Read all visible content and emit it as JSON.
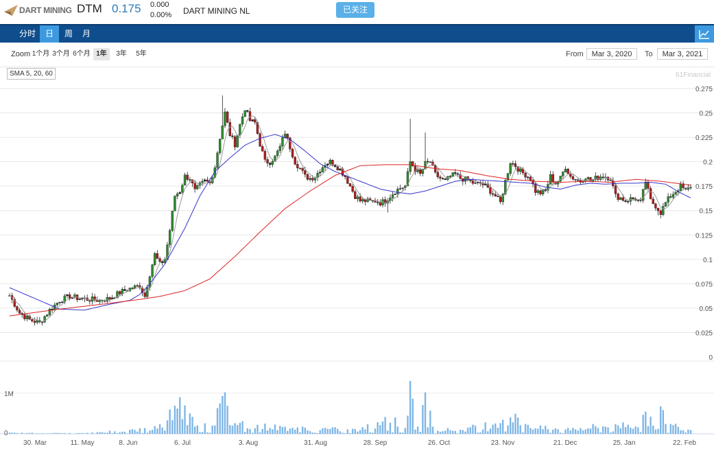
{
  "header": {
    "logo_text": "DART MINING",
    "ticker": "DTM",
    "price": "0.175",
    "change": "0.000",
    "change_pct": "0.00%",
    "company": "DART MINING NL",
    "follow_label": "已关注"
  },
  "nav": {
    "tabs": [
      {
        "label": "分时",
        "active": false
      },
      {
        "label": "日",
        "active": true
      },
      {
        "label": "周",
        "active": false
      },
      {
        "label": "月",
        "active": false
      }
    ],
    "chart_toggle_icon": "line-chart-icon"
  },
  "toolbar": {
    "zoom_label": "Zoom",
    "zoom_options": [
      {
        "label": "1个月",
        "active": false
      },
      {
        "label": "3个月",
        "active": false
      },
      {
        "label": "6个月",
        "active": false
      },
      {
        "label": "1年",
        "active": true
      },
      {
        "label": "3年",
        "active": false
      },
      {
        "label": "5年",
        "active": false
      }
    ],
    "from_label": "From",
    "from_value": "Mar 3, 2020",
    "to_label": "To",
    "to_value": "Mar 3, 2021"
  },
  "indicator_label": "SMA 5, 20, 60",
  "credit": "61Financial",
  "colors": {
    "up": "#2e8b2e",
    "down": "#b01c1c",
    "sma5": "#999999",
    "sma20": "#3333cc",
    "sma60": "#dd2222",
    "volume": "#7eb6e6",
    "nav_bg": "#0f4d8c",
    "accent": "#3d9ae0"
  },
  "chart_data": {
    "type": "candlestick",
    "y_ticks": [
      "0.275",
      "0.25",
      "0.225",
      "0.2",
      "0.175",
      "0.15",
      "0.125",
      "0.1",
      "0.075",
      "0.05",
      "0.025",
      "0"
    ],
    "ylim": [
      0,
      0.275
    ],
    "volume_ticks": [
      "1M",
      "0"
    ],
    "x_ticks": [
      "30. Mar",
      "11. May",
      "8. Jun",
      "6. Jul",
      "3. Aug",
      "31. Aug",
      "28. Sep",
      "26. Oct",
      "23. Nov",
      "21. Dec",
      "25. Jan",
      "22. Feb"
    ],
    "series": [
      {
        "name": "SMA 5",
        "kind": "line"
      },
      {
        "name": "SMA 20",
        "kind": "line"
      },
      {
        "name": "SMA 60",
        "kind": "line"
      }
    ],
    "sma20_knots": [
      [
        0,
        0.071
      ],
      [
        10,
        0.06
      ],
      [
        20,
        0.049
      ],
      [
        30,
        0.048
      ],
      [
        40,
        0.054
      ],
      [
        48,
        0.058
      ],
      [
        52,
        0.064
      ],
      [
        56,
        0.075
      ],
      [
        62,
        0.095
      ],
      [
        70,
        0.132
      ],
      [
        76,
        0.165
      ],
      [
        82,
        0.19
      ],
      [
        88,
        0.204
      ],
      [
        94,
        0.217
      ],
      [
        100,
        0.224
      ],
      [
        106,
        0.228
      ],
      [
        112,
        0.223
      ],
      [
        118,
        0.211
      ],
      [
        124,
        0.198
      ],
      [
        130,
        0.19
      ],
      [
        136,
        0.184
      ],
      [
        142,
        0.178
      ],
      [
        148,
        0.172
      ],
      [
        154,
        0.169
      ],
      [
        160,
        0.167
      ],
      [
        166,
        0.17
      ],
      [
        172,
        0.175
      ],
      [
        178,
        0.18
      ],
      [
        184,
        0.182
      ],
      [
        190,
        0.181
      ],
      [
        196,
        0.18
      ],
      [
        202,
        0.179
      ],
      [
        208,
        0.178
      ],
      [
        214,
        0.174
      ],
      [
        220,
        0.172
      ],
      [
        226,
        0.176
      ],
      [
        232,
        0.178
      ],
      [
        238,
        0.177
      ],
      [
        244,
        0.178
      ],
      [
        250,
        0.178
      ],
      [
        256,
        0.179
      ],
      [
        262,
        0.177
      ],
      [
        268,
        0.168
      ],
      [
        272,
        0.163
      ]
    ],
    "sma60_knots": [
      [
        0,
        0.042
      ],
      [
        20,
        0.049
      ],
      [
        40,
        0.055
      ],
      [
        52,
        0.059
      ],
      [
        60,
        0.062
      ],
      [
        70,
        0.068
      ],
      [
        80,
        0.08
      ],
      [
        90,
        0.103
      ],
      [
        100,
        0.128
      ],
      [
        110,
        0.152
      ],
      [
        120,
        0.17
      ],
      [
        130,
        0.186
      ],
      [
        140,
        0.196
      ],
      [
        150,
        0.197
      ],
      [
        160,
        0.197
      ],
      [
        170,
        0.193
      ],
      [
        180,
        0.191
      ],
      [
        190,
        0.186
      ],
      [
        200,
        0.182
      ],
      [
        210,
        0.18
      ],
      [
        220,
        0.179
      ],
      [
        230,
        0.18
      ],
      [
        240,
        0.179
      ],
      [
        250,
        0.182
      ],
      [
        260,
        0.18
      ],
      [
        272,
        0.176
      ]
    ],
    "anchors": [
      [
        0,
        0.063
      ],
      [
        4,
        0.045
      ],
      [
        8,
        0.038
      ],
      [
        12,
        0.035
      ],
      [
        16,
        0.048
      ],
      [
        20,
        0.058
      ],
      [
        24,
        0.062
      ],
      [
        28,
        0.06
      ],
      [
        32,
        0.059
      ],
      [
        36,
        0.058
      ],
      [
        40,
        0.06
      ],
      [
        44,
        0.066
      ],
      [
        48,
        0.07
      ],
      [
        52,
        0.073
      ],
      [
        54,
        0.062
      ],
      [
        56,
        0.085
      ],
      [
        58,
        0.105
      ],
      [
        60,
        0.095
      ],
      [
        62,
        0.1
      ],
      [
        64,
        0.13
      ],
      [
        66,
        0.165
      ],
      [
        68,
        0.17
      ],
      [
        70,
        0.185
      ],
      [
        72,
        0.183
      ],
      [
        74,
        0.17
      ],
      [
        76,
        0.176
      ],
      [
        78,
        0.18
      ],
      [
        80,
        0.178
      ],
      [
        82,
        0.195
      ],
      [
        84,
        0.225
      ],
      [
        86,
        0.25
      ],
      [
        88,
        0.228
      ],
      [
        90,
        0.218
      ],
      [
        92,
        0.238
      ],
      [
        94,
        0.255
      ],
      [
        96,
        0.242
      ],
      [
        98,
        0.24
      ],
      [
        100,
        0.218
      ],
      [
        102,
        0.2
      ],
      [
        104,
        0.2
      ],
      [
        106,
        0.205
      ],
      [
        108,
        0.215
      ],
      [
        110,
        0.23
      ],
      [
        112,
        0.215
      ],
      [
        114,
        0.2
      ],
      [
        116,
        0.193
      ],
      [
        118,
        0.185
      ],
      [
        120,
        0.183
      ],
      [
        122,
        0.185
      ],
      [
        124,
        0.192
      ],
      [
        126,
        0.198
      ],
      [
        128,
        0.2
      ],
      [
        130,
        0.197
      ],
      [
        132,
        0.192
      ],
      [
        134,
        0.185
      ],
      [
        136,
        0.175
      ],
      [
        138,
        0.165
      ],
      [
        140,
        0.16
      ],
      [
        142,
        0.16
      ],
      [
        144,
        0.159
      ],
      [
        146,
        0.16
      ],
      [
        148,
        0.158
      ],
      [
        150,
        0.16
      ],
      [
        152,
        0.165
      ],
      [
        154,
        0.17
      ],
      [
        156,
        0.173
      ],
      [
        158,
        0.175
      ],
      [
        160,
        0.2
      ],
      [
        162,
        0.192
      ],
      [
        164,
        0.187
      ],
      [
        166,
        0.198
      ],
      [
        168,
        0.2
      ],
      [
        170,
        0.187
      ],
      [
        172,
        0.183
      ],
      [
        174,
        0.18
      ],
      [
        176,
        0.185
      ],
      [
        178,
        0.187
      ],
      [
        180,
        0.183
      ],
      [
        182,
        0.182
      ],
      [
        184,
        0.18
      ],
      [
        186,
        0.177
      ],
      [
        188,
        0.178
      ],
      [
        190,
        0.175
      ],
      [
        192,
        0.17
      ],
      [
        194,
        0.165
      ],
      [
        196,
        0.158
      ],
      [
        198,
        0.18
      ],
      [
        200,
        0.2
      ],
      [
        202,
        0.196
      ],
      [
        204,
        0.19
      ],
      [
        206,
        0.187
      ],
      [
        208,
        0.183
      ],
      [
        210,
        0.17
      ],
      [
        212,
        0.168
      ],
      [
        214,
        0.17
      ],
      [
        216,
        0.185
      ],
      [
        218,
        0.178
      ],
      [
        220,
        0.183
      ],
      [
        222,
        0.195
      ],
      [
        224,
        0.185
      ],
      [
        226,
        0.182
      ],
      [
        228,
        0.18
      ],
      [
        230,
        0.185
      ],
      [
        232,
        0.18
      ],
      [
        234,
        0.183
      ],
      [
        236,
        0.185
      ],
      [
        238,
        0.185
      ],
      [
        240,
        0.183
      ],
      [
        242,
        0.165
      ],
      [
        244,
        0.163
      ],
      [
        246,
        0.16
      ],
      [
        248,
        0.162
      ],
      [
        250,
        0.162
      ],
      [
        252,
        0.158
      ],
      [
        254,
        0.18
      ],
      [
        256,
        0.16
      ],
      [
        258,
        0.155
      ],
      [
        260,
        0.148
      ],
      [
        262,
        0.158
      ],
      [
        264,
        0.165
      ],
      [
        266,
        0.17
      ],
      [
        268,
        0.175
      ],
      [
        270,
        0.17
      ],
      [
        272,
        0.175
      ]
    ],
    "spikes": [
      [
        85,
        0.268
      ],
      [
        160,
        0.244
      ],
      [
        166,
        0.23
      ],
      [
        151,
        0.148
      ],
      [
        259,
        0.145
      ]
    ],
    "volume_knots": [
      [
        0,
        0.03
      ],
      [
        30,
        0.02
      ],
      [
        40,
        0.08
      ],
      [
        56,
        0.15
      ],
      [
        60,
        0.28
      ],
      [
        64,
        0.6
      ],
      [
        68,
        0.9
      ],
      [
        72,
        0.5
      ],
      [
        80,
        0.3
      ],
      [
        84,
        0.75
      ],
      [
        86,
        1.02
      ],
      [
        88,
        0.4
      ],
      [
        100,
        0.25
      ],
      [
        110,
        0.2
      ],
      [
        120,
        0.18
      ],
      [
        140,
        0.12
      ],
      [
        150,
        0.5
      ],
      [
        158,
        0.3
      ],
      [
        160,
        1.3
      ],
      [
        163,
        0.25
      ],
      [
        166,
        1.02
      ],
      [
        170,
        0.15
      ],
      [
        180,
        0.12
      ],
      [
        190,
        0.3
      ],
      [
        200,
        0.55
      ],
      [
        210,
        0.2
      ],
      [
        220,
        0.15
      ],
      [
        230,
        0.2
      ],
      [
        240,
        0.3
      ],
      [
        250,
        0.3
      ],
      [
        254,
        0.5
      ],
      [
        258,
        0.55
      ],
      [
        260,
        0.82
      ],
      [
        262,
        0.3
      ],
      [
        272,
        0.2
      ]
    ],
    "volume_max": 1.3
  }
}
